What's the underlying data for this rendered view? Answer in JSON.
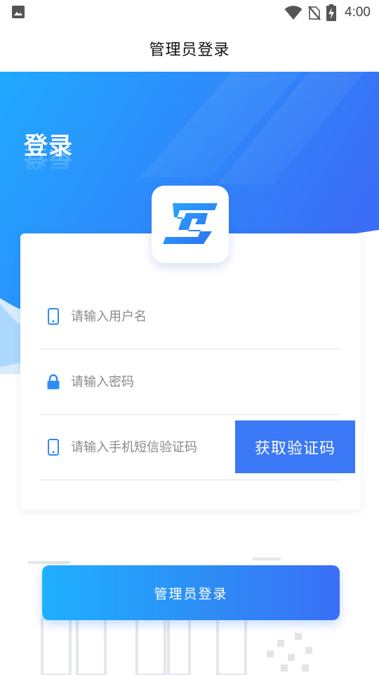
{
  "status_bar": {
    "time": "4:00",
    "icons": [
      "gallery-icon",
      "wifi-icon",
      "no-sim-icon",
      "battery-charging-icon"
    ]
  },
  "header": {
    "title": "管理员登录"
  },
  "hero": {
    "title": "登录",
    "gradient_start": "#22a7ff",
    "gradient_end": "#3a72f6"
  },
  "form": {
    "username": {
      "placeholder": "请输入用户名",
      "icon": "phone-icon",
      "value": ""
    },
    "password": {
      "placeholder": "请输入密码",
      "icon": "lock-icon",
      "value": ""
    },
    "sms_code": {
      "placeholder": "请输入手机短信验证码",
      "icon": "phone-icon",
      "value": ""
    },
    "get_code_label": "获取验证码"
  },
  "login_button_label": "管理员登录",
  "colors": {
    "accent": "#3a78f5",
    "icon_blue": "#2f8cf3",
    "divider": "#e4e4e4"
  }
}
